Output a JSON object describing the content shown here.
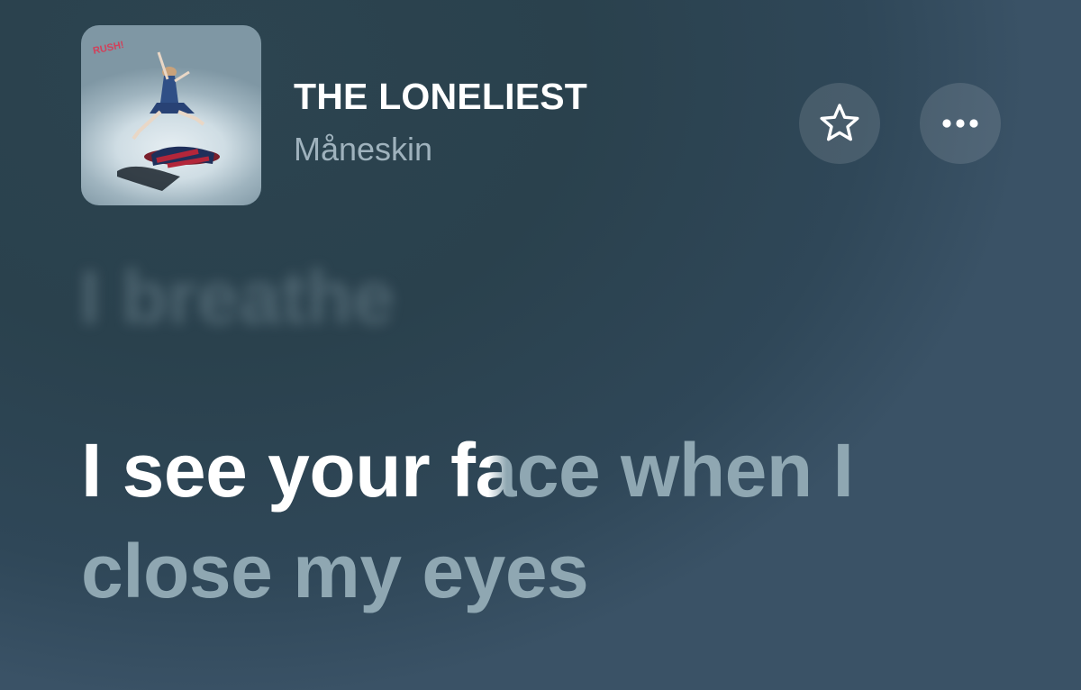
{
  "track": {
    "title": "THE LONELIEST",
    "artist": "Måneskin"
  },
  "artwork": {
    "alt_text": "RUSH!"
  },
  "buttons": {
    "favorite_icon": "star-icon",
    "more_icon": "ellipsis-icon"
  },
  "lyrics": {
    "previous_line": "I breathe",
    "current_line": {
      "sung": "I see your f",
      "partial": "a",
      "unsung_line1": "ce when I",
      "unsung_line2": "close my eyes"
    }
  },
  "colors": {
    "background": "#2a414d",
    "sung_text": "#ffffff",
    "unsung_text": "#8fa7b2",
    "artist_text": "#9fb2bd"
  }
}
